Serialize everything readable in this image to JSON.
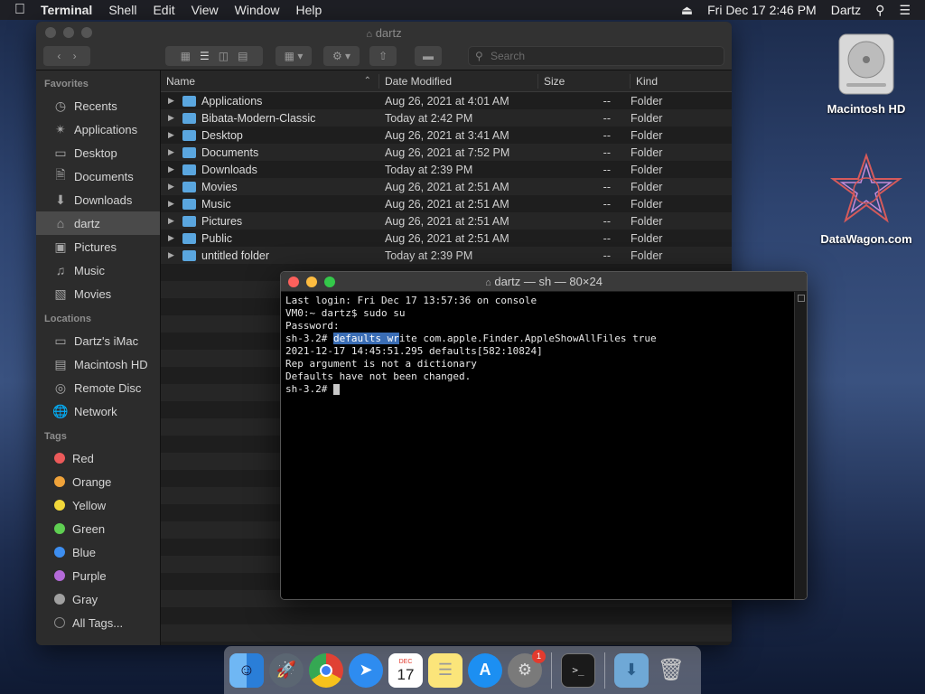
{
  "menubar": {
    "app": "Terminal",
    "items": [
      "Shell",
      "Edit",
      "View",
      "Window",
      "Help"
    ],
    "datetime": "Fri Dec 17  2:46 PM",
    "user": "Dartz"
  },
  "finder": {
    "title": "dartz",
    "search_placeholder": "Search",
    "sidebar": {
      "favorites_label": "Favorites",
      "favorites": [
        "Recents",
        "Applications",
        "Desktop",
        "Documents",
        "Downloads",
        "dartz",
        "Pictures",
        "Music",
        "Movies"
      ],
      "locations_label": "Locations",
      "locations": [
        "Dartz's iMac",
        "Macintosh HD",
        "Remote Disc",
        "Network"
      ],
      "tags_label": "Tags",
      "tags": [
        {
          "name": "Red",
          "color": "#ec5a5a"
        },
        {
          "name": "Orange",
          "color": "#f0a33a"
        },
        {
          "name": "Yellow",
          "color": "#f2d83a"
        },
        {
          "name": "Green",
          "color": "#5fcf52"
        },
        {
          "name": "Blue",
          "color": "#3d8ef0"
        },
        {
          "name": "Purple",
          "color": "#b46ad9"
        },
        {
          "name": "Gray",
          "color": "#a0a0a0"
        }
      ],
      "all_tags": "All Tags..."
    },
    "columns": {
      "name": "Name",
      "date": "Date Modified",
      "size": "Size",
      "kind": "Kind"
    },
    "files": [
      {
        "name": "Applications",
        "date": "Aug 26, 2021 at 4:01 AM",
        "size": "--",
        "kind": "Folder"
      },
      {
        "name": "Bibata-Modern-Classic",
        "date": "Today at 2:42 PM",
        "size": "--",
        "kind": "Folder"
      },
      {
        "name": "Desktop",
        "date": "Aug 26, 2021 at 3:41 AM",
        "size": "--",
        "kind": "Folder"
      },
      {
        "name": "Documents",
        "date": "Aug 26, 2021 at 7:52 PM",
        "size": "--",
        "kind": "Folder"
      },
      {
        "name": "Downloads",
        "date": "Today at 2:39 PM",
        "size": "--",
        "kind": "Folder"
      },
      {
        "name": "Movies",
        "date": "Aug 26, 2021 at 2:51 AM",
        "size": "--",
        "kind": "Folder"
      },
      {
        "name": "Music",
        "date": "Aug 26, 2021 at 2:51 AM",
        "size": "--",
        "kind": "Folder"
      },
      {
        "name": "Pictures",
        "date": "Aug 26, 2021 at 2:51 AM",
        "size": "--",
        "kind": "Folder"
      },
      {
        "name": "Public",
        "date": "Aug 26, 2021 at 2:51 AM",
        "size": "--",
        "kind": "Folder"
      },
      {
        "name": "untitled folder",
        "date": "Today at 2:39 PM",
        "size": "--",
        "kind": "Folder"
      }
    ]
  },
  "terminal": {
    "title": "dartz — sh — 80×24",
    "lines": {
      "l1": "Last login: Fri Dec 17 13:57:36 on console",
      "l2": "VM0:~ dartz$ sudo su",
      "l3": "Password:",
      "l4_prompt": "sh-3.2# ",
      "l4_selected": "defaults wr",
      "l4_rest": "ite com.apple.Finder.AppleShowAllFiles true",
      "l5": "2021-12-17 14:45:51.295 defaults[582:10824]",
      "l6": "Rep argument is not a dictionary",
      "l7": "Defaults have not been changed.",
      "l8": "sh-3.2# "
    }
  },
  "desktop": {
    "icons": [
      "Macintosh HD",
      "DataWagon.com"
    ]
  },
  "dock": {
    "calendar_month": "DEC",
    "calendar_day": "17",
    "settings_badge": "1"
  }
}
